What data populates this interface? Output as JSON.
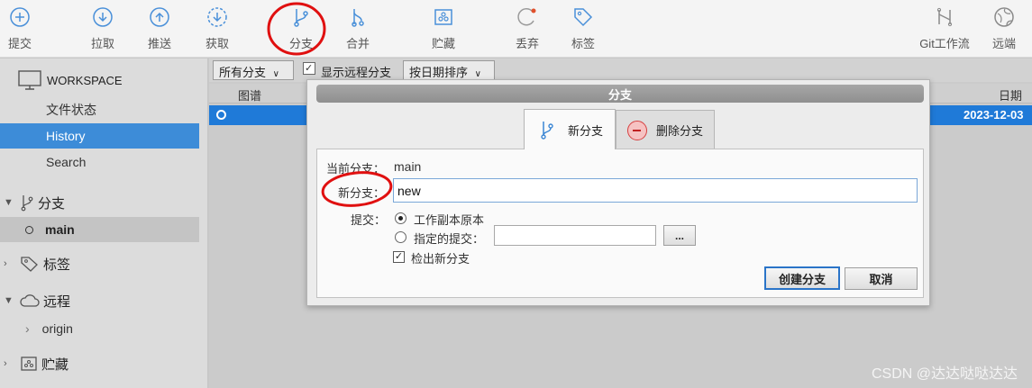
{
  "toolbar": {
    "commit": "提交",
    "pull": "拉取",
    "push": "推送",
    "fetch": "获取",
    "branch": "分支",
    "merge": "合并",
    "stash": "贮藏",
    "discard": "丢弃",
    "tag": "标签",
    "git_flow": "Git工作流",
    "remote": "远端"
  },
  "sidebar": {
    "workspace": "WORKSPACE",
    "file_status": "文件状态",
    "history": "History",
    "search": "Search",
    "branches": "分支",
    "branch_main": "main",
    "tags": "标签",
    "remotes": "远程",
    "remote_origin": "origin",
    "stashes": "贮藏"
  },
  "main": {
    "branch_filter": "所有分支",
    "show_remote": "显示远程分支",
    "sort_order": "按日期排序",
    "col_graph": "图谱",
    "col_date": "日期",
    "row_date": "2023-12-03"
  },
  "dialog": {
    "title": "分支",
    "tab_new": "新分支",
    "tab_delete": "删除分支",
    "current_branch_label": "当前分支：",
    "current_branch_value": "main",
    "new_branch_label": "新分支：",
    "new_branch_value": "new",
    "commit_label": "提交：",
    "opt_working_copy": "工作副本原本",
    "opt_specified": "指定的提交：",
    "specified_value": "",
    "browse": "...",
    "checkout_label": "检出新分支",
    "create_button": "创建分支",
    "cancel_button": "取消"
  },
  "watermark": "CSDN @达达哒哒达达",
  "colors": {
    "accent": "#3d8cd8",
    "selected_row": "#1f7ad8",
    "annotation_red": "#e01010"
  }
}
